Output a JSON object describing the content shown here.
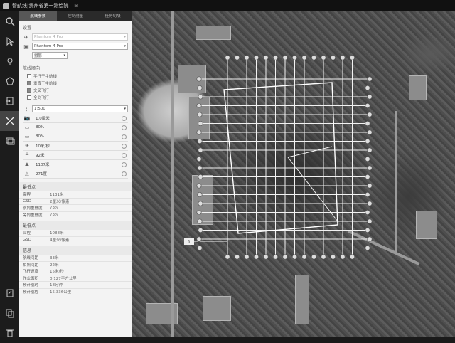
{
  "window": {
    "title": "智航线|贵州省第一测绘院",
    "close": "⊠"
  },
  "toolbar": [
    "search-icon",
    "select-arrow-icon",
    "pin-icon",
    "polygon-icon",
    "import-icon",
    "route-edit-icon",
    "layers-icon",
    "export-icon",
    "copy-icon",
    "trash-icon"
  ],
  "tabs": [
    {
      "label": "航线参数",
      "active": true
    },
    {
      "label": "控制测量",
      "active": false
    },
    {
      "label": "任务切块",
      "active": false
    }
  ],
  "device": {
    "header": "设置",
    "aircraft": "Phantom 4 Pro",
    "camera": "Phantom 4 Pro",
    "mode": "摄影"
  },
  "route_options": {
    "header": "航线顺向",
    "checks": [
      {
        "label": "平行于主航线",
        "on": false
      },
      {
        "label": "垂直于主航线",
        "on": true
      },
      {
        "label": "交叉飞行",
        "on": true
      },
      {
        "label": "全向飞行",
        "on": false
      }
    ]
  },
  "scale": "1:500",
  "settings": [
    {
      "icon": "📷",
      "value": "1.0厘米"
    },
    {
      "icon": "▭",
      "value": "80%"
    },
    {
      "icon": "▭",
      "value": "80%"
    },
    {
      "icon": "✈",
      "value": "10米/秒"
    },
    {
      "icon": "┴",
      "value": "92米"
    },
    {
      "icon": "⛰",
      "value": "1107米"
    },
    {
      "icon": "◬",
      "value": "271度"
    }
  ],
  "stats_top": {
    "header": "最低点",
    "rows": [
      {
        "k": "高程",
        "v": "1131米"
      },
      {
        "k": "GSD",
        "v": "2厘米/像素"
      },
      {
        "k": "航向重叠度",
        "v": "73%"
      },
      {
        "k": "旁向重叠度",
        "v": "73%"
      }
    ]
  },
  "stats_mid": {
    "header": "最低点",
    "rows": [
      {
        "k": "高程",
        "v": "1088米"
      },
      {
        "k": "GSD",
        "v": "4厘米/像素"
      }
    ]
  },
  "stats_info": {
    "header": "信息",
    "rows": [
      {
        "k": "航线间距",
        "v": "33米"
      },
      {
        "k": "拍照间距",
        "v": "22米"
      },
      {
        "k": "飞行速度",
        "v": "15米/秒"
      },
      {
        "k": "作业面积",
        "v": "0.127平方公里"
      },
      {
        "k": "预计航时",
        "v": "18分钟"
      },
      {
        "k": "预计航程",
        "v": "15.336公里"
      }
    ]
  },
  "map": {
    "waypoint_label": "1"
  }
}
